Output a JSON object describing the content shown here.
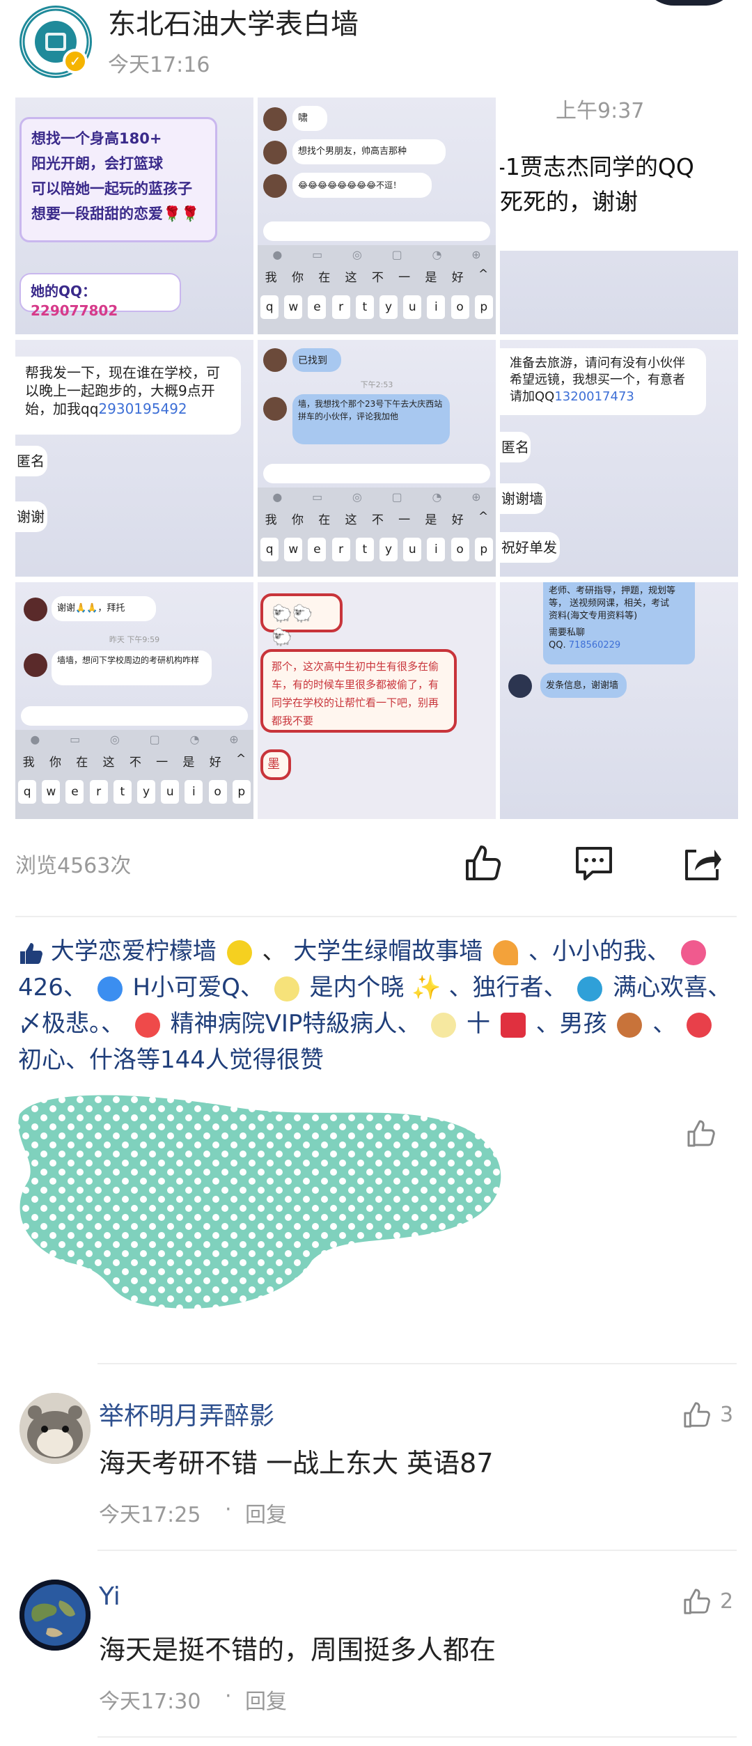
{
  "post": {
    "title": "东北石油大学表白墙",
    "time": "今天17:16"
  },
  "images": {
    "c1": {
      "card_lines": [
        "想找一个身高180+",
        "阳光开朗，会打篮球",
        "可以陪她一起玩的蓝孩子",
        "想要一段甜甜的恋爱🌹🌹"
      ],
      "qq_label": "她的QQ：",
      "qq": "229077802"
    },
    "c2": {
      "msgs": [
        "啸",
        "想找个男朋友，帅高吉那种",
        "😂😂😂😂😂😂😂😂不逗！"
      ]
    },
    "c3": {
      "time_partial": "上午9:37",
      "line1": "-1贾志杰同学的QQ",
      "line2": "死死的，谢谢"
    },
    "c4": {
      "msg": "帮我发一下，现在谁在学校，可以晚上一起跑步的，大概9点开始，加我qq",
      "qq": "2930195492",
      "anon": "匿名",
      "thanks": "谢谢"
    },
    "c5": {
      "found": "已找到",
      "time": "下午2:53",
      "msg": "墙，我想找个那个23号下午去大庆西站拼车的小伙伴，评论我加他"
    },
    "c6": {
      "msg": "准备去旅游，请问有没有小伙伴希望远镜，我想买一个，有意者请加QQ",
      "qq": "1320017473",
      "anon": "匿名",
      "thanks": "谢谢墙",
      "bye": "祝好单发"
    },
    "c7": {
      "thanks": "谢谢🙏🙏，拜托",
      "time": "昨天 下午9:59",
      "msg": "墙墙，想问下学校周边的考研机构咋样"
    },
    "c8": {
      "top": "🐑🐑🐑",
      "msg": "那个，这次高中生初中生有很多在偷车，有的时候车里很多都被偷了，有同学在学校的让帮忙看一下吧，别再都我不要",
      "tail": "墨"
    },
    "c9": {
      "lines": [
        "老师、考研指导，押题，规划等",
        "等，  送视频网课，相关，考试",
        "资料(海文专用资料等)"
      ],
      "qq_prefix": "需要私聊",
      "qq_label": "QQ.",
      "qq": "718560229",
      "send": "发条信息，谢谢墙"
    },
    "keyboard": {
      "cn_row": [
        "我",
        "你",
        "在",
        "这",
        "不",
        "一",
        "是",
        "好"
      ],
      "en_row": [
        "q",
        "w",
        "e",
        "r",
        "t",
        "y",
        "u",
        "i",
        "o",
        "p"
      ]
    }
  },
  "stats": {
    "views": "浏览4563次"
  },
  "likes": {
    "segments": [
      "大学恋爱柠檬墙",
      "、",
      "大学生绿帽故事墙",
      "、小小的我、",
      "426、",
      "H小可爱Q、",
      "是内个晓",
      "、独行者、",
      "满心欢喜、〆极悲。、",
      "精神病院VIP特級病人、",
      "十",
      "、男孩",
      "、",
      "初心、什洛等144人觉得很赞"
    ]
  },
  "comments": [
    {
      "name": "举杯明月弄醉影",
      "text": "海天考研不错 一战上东大 英语87",
      "time": "今天17:25",
      "reply": "回复",
      "likes": "3"
    },
    {
      "name": "Yi",
      "text": "海天是挺不错的，周围挺多人都在",
      "time": "今天17:30",
      "reply": "回复",
      "likes": "2"
    }
  ],
  "colors": {
    "brand_teal": "#1f8a9a",
    "link_blue": "#3d6fd6",
    "name_blue": "#2d4f8e",
    "blur_mint": "#7fd1bd"
  }
}
